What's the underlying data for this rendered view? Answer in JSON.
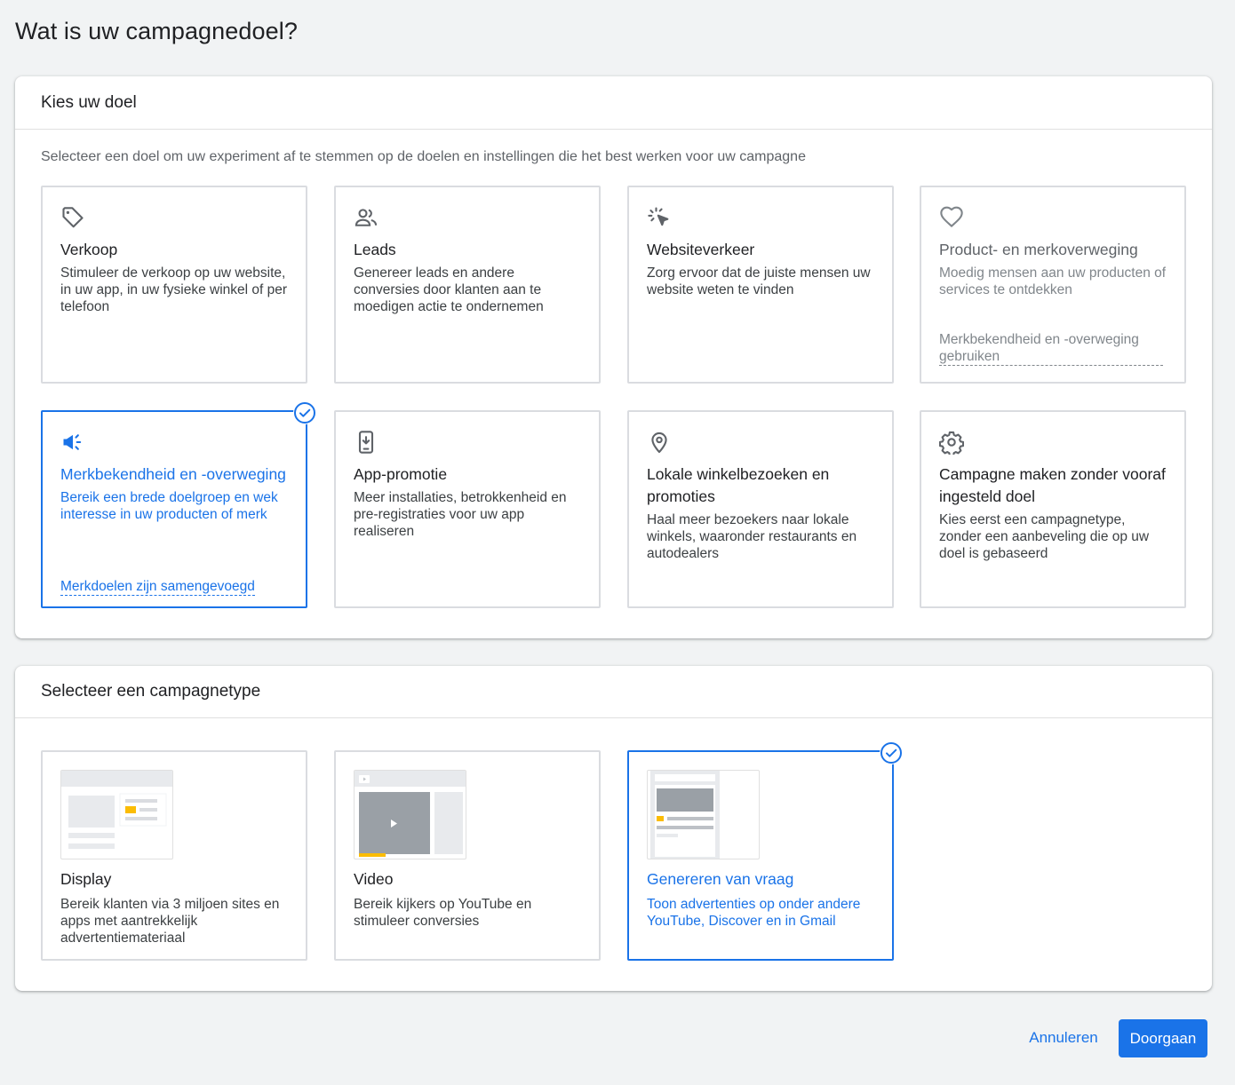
{
  "page": {
    "title": "Wat is uw campagnedoel?"
  },
  "goal_panel": {
    "title": "Kies uw doel",
    "description": "Selecteer een doel om uw experiment af te stemmen op de doelen en instellingen die het best werken voor uw campagne",
    "cards": [
      {
        "icon": "tag-icon",
        "title": "Verkoop",
        "text": "Stimuleer de verkoop op uw website, in uw app, in uw fysieke winkel of per telefoon",
        "state": "default"
      },
      {
        "icon": "people-icon",
        "title": "Leads",
        "text": "Genereer leads en andere conversies door klanten aan te moedigen actie te ondernemen",
        "state": "default"
      },
      {
        "icon": "cursor-click-icon",
        "title": "Websiteverkeer",
        "text": "Zorg ervoor dat de juiste mensen uw website weten te vinden",
        "state": "default"
      },
      {
        "icon": "heart-icon",
        "title": "Product- en merkoverweging",
        "text": "Moedig mensen aan uw producten of services te ontdekken",
        "link": "Merkbekendheid en -overweging gebruiken",
        "state": "disabled"
      },
      {
        "icon": "megaphone-icon",
        "title": "Merkbekendheid en -overweging",
        "text": "Bereik een brede doelgroep en wek interesse in uw producten of merk",
        "link": "Merkdoelen zijn samengevoegd",
        "state": "selected"
      },
      {
        "icon": "phone-download-icon",
        "title": "App-promotie",
        "text": "Meer installaties, betrokkenheid en pre-registraties voor uw app realiseren",
        "state": "default"
      },
      {
        "icon": "location-pin-icon",
        "title": "Lokale winkelbezoeken en promoties",
        "text": "Haal meer bezoekers naar lokale winkels, waaronder restaurants en autodealers",
        "state": "default"
      },
      {
        "icon": "gear-icon",
        "title": "Campagne maken zonder vooraf ingesteld doel",
        "text": "Kies eerst een campagnetype, zonder een aanbeveling die op uw doel is gebaseerd",
        "state": "default"
      }
    ]
  },
  "type_panel": {
    "title": "Selecteer een campagnetype",
    "cards": [
      {
        "thumb": "display-thumbnail",
        "title": "Display",
        "text": "Bereik klanten via 3 miljoen sites en apps met aantrekkelijk advertentiemateriaal",
        "state": "default"
      },
      {
        "thumb": "video-thumbnail",
        "title": "Video",
        "text": "Bereik kijkers op YouTube en stimuleer conversies",
        "state": "default"
      },
      {
        "thumb": "demand-gen-thumbnail",
        "title": "Genereren van vraag",
        "text": "Toon advertenties op onder andere YouTube, Discover en in Gmail",
        "state": "selected"
      }
    ]
  },
  "footer": {
    "cancel_label": "Annuleren",
    "continue_label": "Doorgaan"
  },
  "colors": {
    "accent": "#1a73e8",
    "thumb_yellow": "#fbbc04",
    "border": "#dadce0"
  }
}
